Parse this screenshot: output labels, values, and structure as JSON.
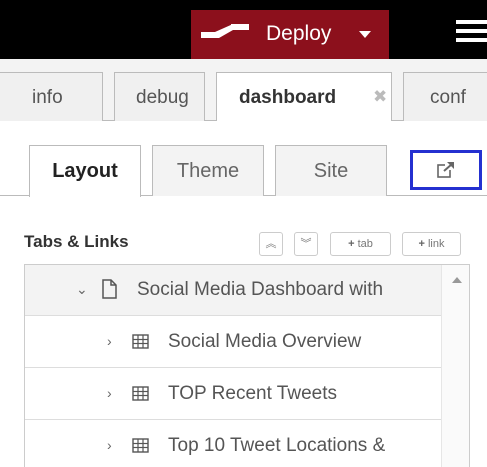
{
  "header": {
    "deploy_label": "Deploy"
  },
  "sidebar_tabs": [
    {
      "label": "info"
    },
    {
      "label": "debug"
    },
    {
      "label": "dashboard"
    },
    {
      "label": "conf"
    }
  ],
  "sub_tabs": [
    {
      "label": "Layout"
    },
    {
      "label": "Theme"
    },
    {
      "label": "Site"
    }
  ],
  "section": {
    "title": "Tabs & Links",
    "add_tab_label": "tab",
    "add_link_label": "link"
  },
  "tree": {
    "group_label": "Social Media Dashboard with",
    "items": [
      {
        "label": "Social Media Overview"
      },
      {
        "label": "TOP Recent Tweets"
      },
      {
        "label": "Top 10 Tweet Locations &"
      }
    ]
  },
  "colors": {
    "header_bg": "#000000",
    "deploy_bg": "#8c101c",
    "highlight_border": "#2430d0"
  }
}
